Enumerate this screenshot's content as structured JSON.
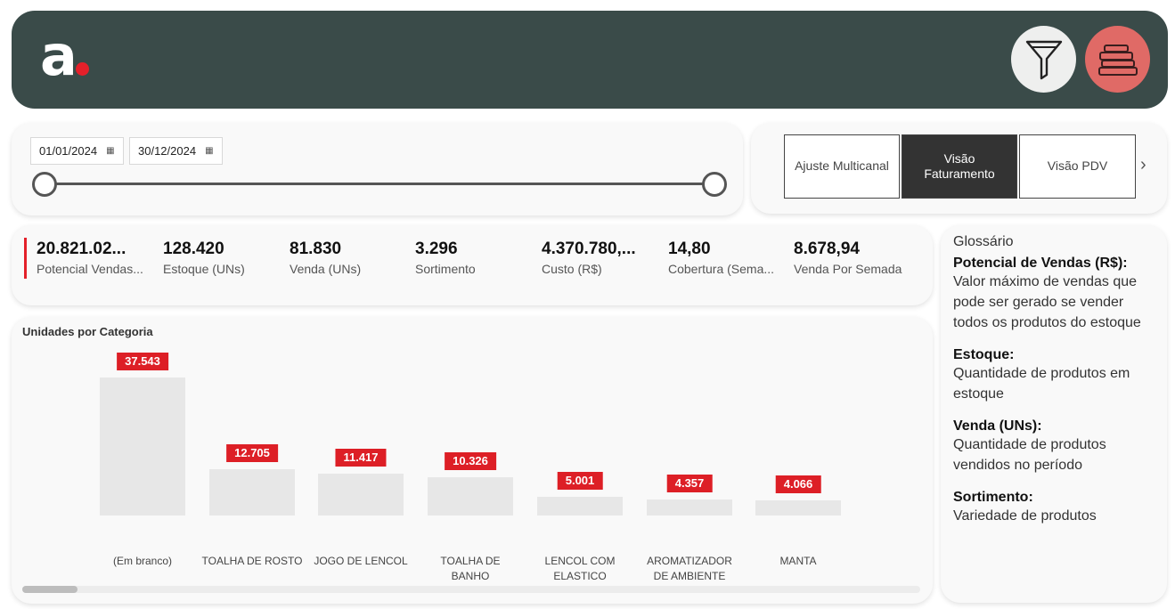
{
  "header": {
    "logo_text": "a",
    "brand_color": "#e4202a",
    "background_color": "#3a4b49"
  },
  "header_buttons": [
    {
      "name": "filter-icon",
      "color": "#eeefee"
    },
    {
      "name": "stacked-items-icon",
      "color": "#e06a66"
    }
  ],
  "date_filter": {
    "start_date": "01/01/2024",
    "end_date": "30/12/2024",
    "calendar_icon": "calendar-icon"
  },
  "view_tabs": [
    {
      "label": "Ajuste Multicanal",
      "active": false
    },
    {
      "label": "Visão Faturamento",
      "active": true
    },
    {
      "label": "Visão PDV",
      "active": false
    }
  ],
  "kpis": [
    {
      "value": "20.821.02...",
      "label": "Potencial Vendas..."
    },
    {
      "value": "128.420",
      "label": "Estoque (UNs)"
    },
    {
      "value": "81.830",
      "label": "Venda (UNs)"
    },
    {
      "value": "3.296",
      "label": "Sortimento"
    },
    {
      "value": "4.370.780,...",
      "label": "Custo (R$)"
    },
    {
      "value": "14,80",
      "label": "Cobertura (Sema..."
    },
    {
      "value": "8.678,94",
      "label": "Venda Por Semada"
    }
  ],
  "chart_data": {
    "type": "bar",
    "title": "Unidades por Categoria",
    "categories": [
      "(Em branco)",
      "TOALHA DE ROSTO",
      "JOGO DE LENCOL",
      "TOALHA DE BANHO",
      "LENCOL COM ELASTICO",
      "AROMATIZADOR DE AMBIENTE",
      "MANTA"
    ],
    "values": [
      37543,
      12705,
      11417,
      10326,
      5001,
      4357,
      4066
    ],
    "data_labels": [
      "37.543",
      "12.705",
      "11.417",
      "10.326",
      "5.001",
      "4.357",
      "4.066"
    ],
    "bar_color": "#e7e7e7",
    "label_color": "#dd1f26",
    "ylim": [
      0,
      37543
    ],
    "grid": false
  },
  "glossary": {
    "title": "Glossário",
    "items": [
      {
        "term": "Potencial de Vendas (R$):",
        "description": "Valor máximo de vendas que pode ser gerado se vender todos os produtos do estoque"
      },
      {
        "term": "Estoque:",
        "description": "Quantidade de produtos em estoque"
      },
      {
        "term": "Venda (UNs):",
        "description": "Quantidade de produtos vendidos no período"
      },
      {
        "term": "Sortimento:",
        "description": "Variedade de produtos"
      }
    ]
  }
}
